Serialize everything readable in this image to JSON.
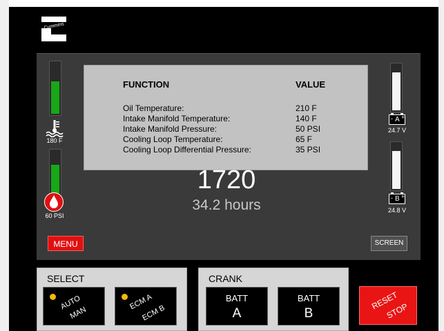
{
  "brand": {
    "logo_text": "Cummins"
  },
  "gauges": {
    "temp": {
      "label": "180 F",
      "level": 0.65,
      "color": "#18a818"
    },
    "oil": {
      "label": "60 PSI",
      "level": 0.7,
      "color": "#18a818"
    },
    "batt_a": {
      "label": "24.7 V",
      "sign_minus": "-",
      "letter": "A",
      "sign_plus": "+",
      "level": 0.85,
      "color": "#f5f5f5"
    },
    "batt_b": {
      "label": "24.8 V",
      "sign_minus": "-",
      "letter": "B",
      "sign_plus": "+",
      "level": 0.85,
      "color": "#f5f5f5"
    }
  },
  "function_table": {
    "header_function": "FUNCTION",
    "header_value": "VALUE",
    "rows": [
      {
        "name": "Oil Temperature:",
        "value": "210 F"
      },
      {
        "name": "Intake Manifold Temperature:",
        "value": "140 F"
      },
      {
        "name": "Intake Manifold Pressure:",
        "value": "50 PSI"
      },
      {
        "name": "Cooling Loop Temperature:",
        "value": "65 F"
      },
      {
        "name": "Cooling Loop Differential Pressure:",
        "value": "35 PSI"
      }
    ]
  },
  "engine": {
    "rpm": "1720",
    "hours": "34.2 hours"
  },
  "buttons": {
    "menu": "MENU",
    "screen": "SCREEN",
    "select_title": "SELECT",
    "auto_top": "AUTO",
    "auto_bottom": "MAN",
    "ecm_top": "ECM A",
    "ecm_bottom": "ECM B",
    "crank_title": "CRANK",
    "batt_label": "BATT",
    "batt_a_letter": "A",
    "batt_b_letter": "B",
    "reset_top": "RESET",
    "reset_bottom": "STOP"
  },
  "colors": {
    "led": "#f2b90b",
    "menu_red": "#e01010",
    "reset_red": "#e91414"
  }
}
